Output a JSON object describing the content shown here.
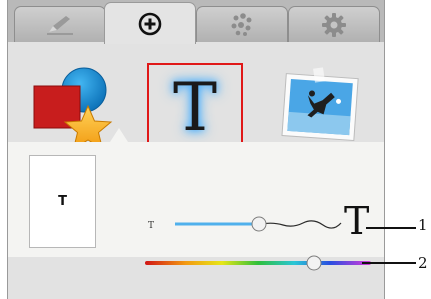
{
  "tabs": [
    {
      "name": "draw-tab",
      "icon": "pencil-icon"
    },
    {
      "name": "add-tab",
      "icon": "plus-circle-icon",
      "active": true
    },
    {
      "name": "effects-tab",
      "icon": "dots-cluster-icon"
    },
    {
      "name": "settings-tab",
      "icon": "gear-icon"
    }
  ],
  "add_options": [
    {
      "name": "shapes-option",
      "icon": "shapes-icon"
    },
    {
      "name": "text-option",
      "label": "T",
      "selected": true
    },
    {
      "name": "photo-option",
      "icon": "photo-icon"
    }
  ],
  "text_settings": {
    "preview_text": "T",
    "size_slider": {
      "min_label": "T",
      "max_label": "T",
      "value": 0.47
    },
    "color_slider": {
      "value": 0.82
    }
  },
  "callouts": [
    "1",
    "2"
  ],
  "colors": {
    "selection": "#e01818",
    "accent": "#39a9ff"
  }
}
